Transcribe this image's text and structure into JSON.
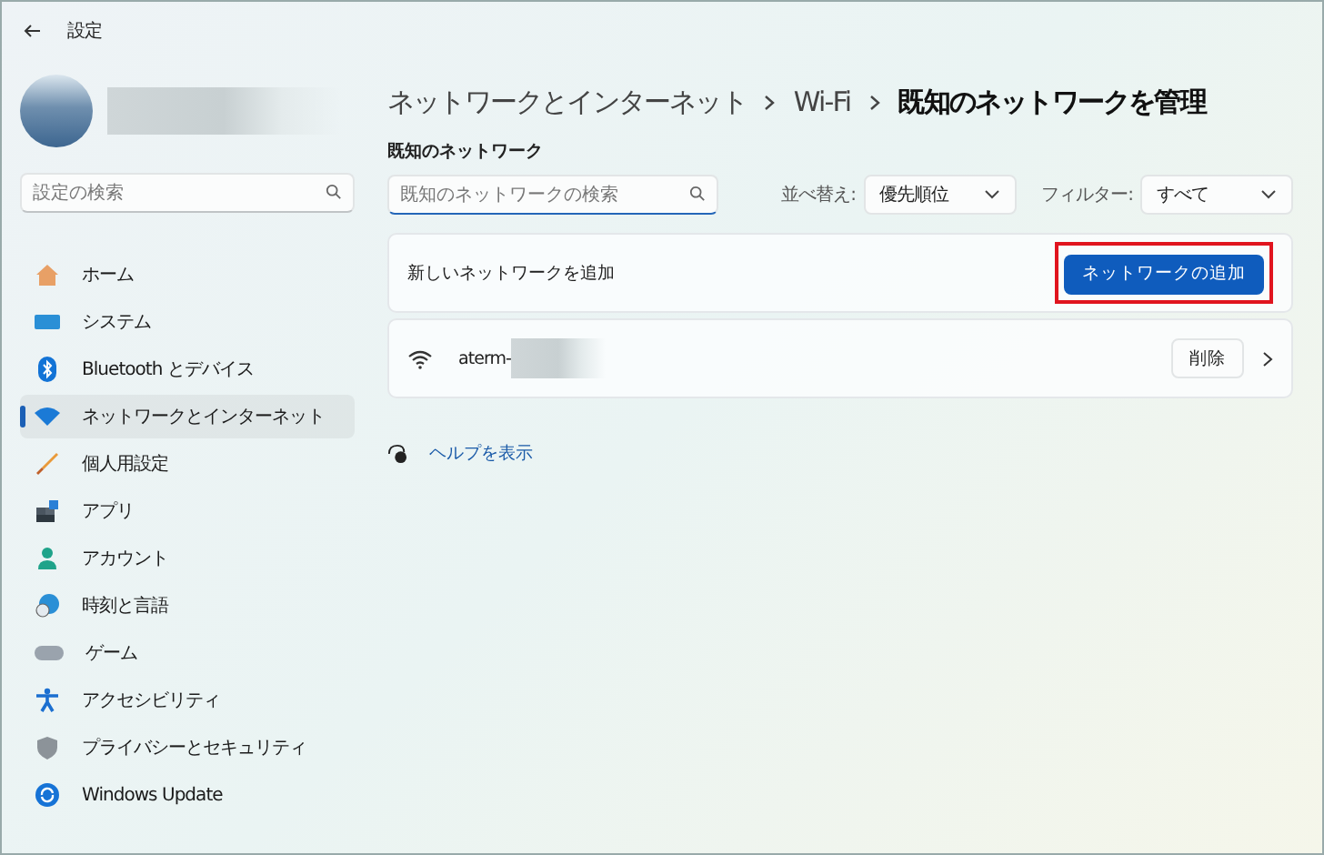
{
  "window": {
    "title": "設定"
  },
  "sidebar": {
    "search": {
      "placeholder": "設定の検索"
    },
    "items": [
      {
        "label": "ホーム",
        "selected": false
      },
      {
        "label": "システム",
        "selected": false
      },
      {
        "label": "Bluetooth とデバイス",
        "selected": false
      },
      {
        "label": "ネットワークとインターネット",
        "selected": true
      },
      {
        "label": "個人用設定",
        "selected": false
      },
      {
        "label": "アプリ",
        "selected": false
      },
      {
        "label": "アカウント",
        "selected": false
      },
      {
        "label": "時刻と言語",
        "selected": false
      },
      {
        "label": "ゲーム",
        "selected": false
      },
      {
        "label": "アクセシビリティ",
        "selected": false
      },
      {
        "label": "プライバシーとセキュリティ",
        "selected": false
      },
      {
        "label": "Windows Update",
        "selected": false
      }
    ]
  },
  "breadcrumb": [
    "ネットワークとインターネット",
    "Wi-Fi",
    "既知のネットワークを管理"
  ],
  "section_title": "既知のネットワーク",
  "search": {
    "placeholder": "既知のネットワークの検索"
  },
  "sort": {
    "label": "並べ替え:",
    "value": "優先順位"
  },
  "filter": {
    "label": "フィルター:",
    "value": "すべて"
  },
  "add_card": {
    "label": "新しいネットワークを追加",
    "button": "ネットワークの追加",
    "highlighted": true
  },
  "networks": [
    {
      "name": "aterm-",
      "action": "削除"
    }
  ],
  "help": "ヘルプを表示"
}
